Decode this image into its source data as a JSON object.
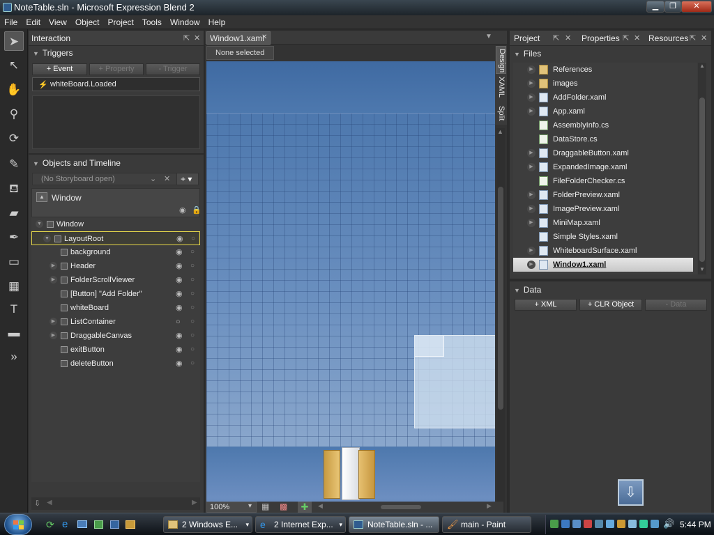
{
  "window": {
    "title": "NoteTable.sln - Microsoft Expression Blend 2"
  },
  "menu": [
    "File",
    "Edit",
    "View",
    "Object",
    "Project",
    "Tools",
    "Window",
    "Help"
  ],
  "interaction": {
    "tab_label": "Interaction",
    "triggers_header": "Triggers",
    "buttons": [
      "+ Event",
      "+ Property",
      "- Trigger"
    ],
    "trigger_item": "whiteBoard.Loaded"
  },
  "objects": {
    "header": "Objects and Timeline",
    "storyboard_placeholder": "(No Storyboard open)",
    "scope": "Window",
    "tree": [
      {
        "label": "Window",
        "depth": 0,
        "expand": true,
        "visible": false
      },
      {
        "label": "LayoutRoot",
        "depth": 1,
        "expand": true,
        "selected": true,
        "visible": true
      },
      {
        "label": "background",
        "depth": 2,
        "expand": false,
        "visible": true
      },
      {
        "label": "Header",
        "depth": 2,
        "expand": true,
        "visible": true
      },
      {
        "label": "FolderScrollViewer",
        "depth": 2,
        "expand": true,
        "visible": true
      },
      {
        "label": "[Button] \"Add Folder\"",
        "depth": 2,
        "expand": false,
        "visible": true
      },
      {
        "label": "whiteBoard",
        "depth": 2,
        "expand": false,
        "visible": true
      },
      {
        "label": "ListContainer",
        "depth": 2,
        "expand": true,
        "visible": false
      },
      {
        "label": "DraggableCanvas",
        "depth": 2,
        "expand": true,
        "visible": true
      },
      {
        "label": "exitButton",
        "depth": 2,
        "expand": false,
        "visible": true
      },
      {
        "label": "deleteButton",
        "depth": 2,
        "expand": false,
        "visible": true
      }
    ]
  },
  "document": {
    "tab_label": "Window1.xaml",
    "selection_status": "None selected",
    "view_tabs": [
      "Design",
      "XAML",
      "Split"
    ],
    "zoom": "100%"
  },
  "project": {
    "tabs": [
      "Project",
      "Properties",
      "Resources"
    ],
    "files_header": "Files",
    "files": [
      {
        "name": "References",
        "type": "folder",
        "expand": true
      },
      {
        "name": "images",
        "type": "folder",
        "expand": true
      },
      {
        "name": "AddFolder.xaml",
        "type": "xaml",
        "expand": true
      },
      {
        "name": "App.xaml",
        "type": "xaml",
        "expand": true
      },
      {
        "name": "AssemblyInfo.cs",
        "type": "cs",
        "expand": false
      },
      {
        "name": "DataStore.cs",
        "type": "cs",
        "expand": false
      },
      {
        "name": "DraggableButton.xaml",
        "type": "xaml",
        "expand": true
      },
      {
        "name": "ExpandedImage.xaml",
        "type": "xaml",
        "expand": true
      },
      {
        "name": "FileFolderChecker.cs",
        "type": "cs",
        "expand": false
      },
      {
        "name": "FolderPreview.xaml",
        "type": "xaml",
        "expand": true
      },
      {
        "name": "ImagePreview.xaml",
        "type": "xaml",
        "expand": true
      },
      {
        "name": "MiniMap.xaml",
        "type": "xaml",
        "expand": true
      },
      {
        "name": "Simple Styles.xaml",
        "type": "xaml",
        "expand": false
      },
      {
        "name": "WhiteboardSurface.xaml",
        "type": "xaml",
        "expand": true
      },
      {
        "name": "Window1.xaml",
        "type": "xaml",
        "expand": true,
        "selected": true
      }
    ]
  },
  "data_panel": {
    "header": "Data",
    "buttons": [
      "+ XML",
      "+ CLR Object",
      "- Data"
    ]
  },
  "taskbar": {
    "items": [
      "2 Windows E...",
      "2 Internet Exp...",
      "NoteTable.sln - ...",
      "main - Paint"
    ],
    "clock": "5:44 PM"
  }
}
